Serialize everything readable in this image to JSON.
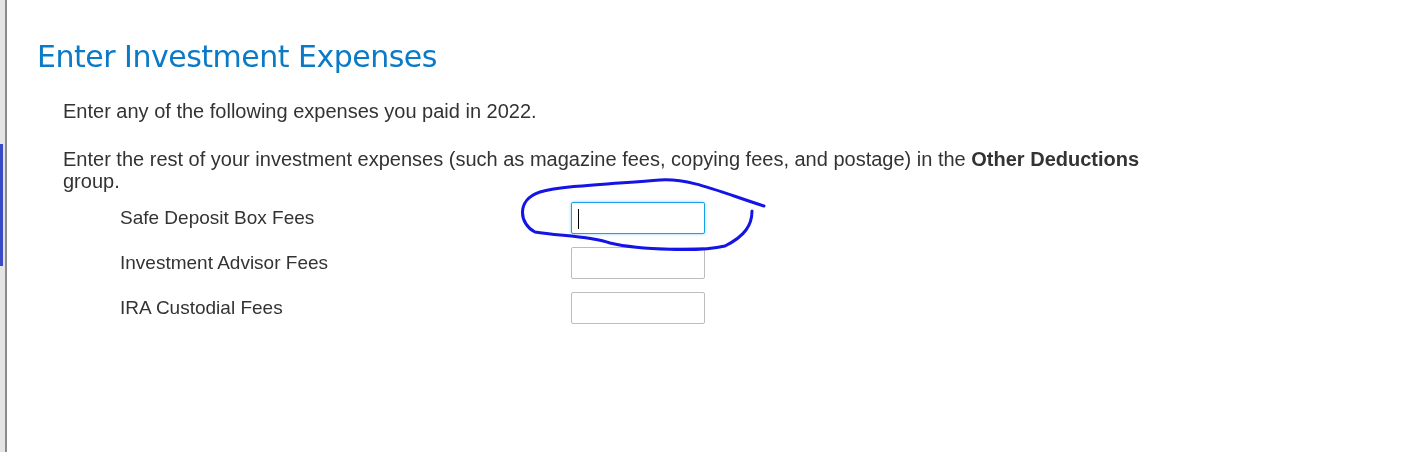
{
  "title": "Enter Investment Expenses",
  "paragraphs": [
    "Enter any of the following expenses you paid in 2022.",
    "Enter the rest of your investment expenses (such as magazine fees, copying fees, and postage) in the **Other Deductions** group."
  ],
  "fields": [
    {
      "label": "Safe Deposit Box Fees",
      "focused": true
    },
    {
      "label": "Investment Advisor Fees",
      "focused": false
    },
    {
      "label": "IRA Custodial Fees",
      "focused": false
    }
  ],
  "annotation": {
    "kind": "loop"
  }
}
